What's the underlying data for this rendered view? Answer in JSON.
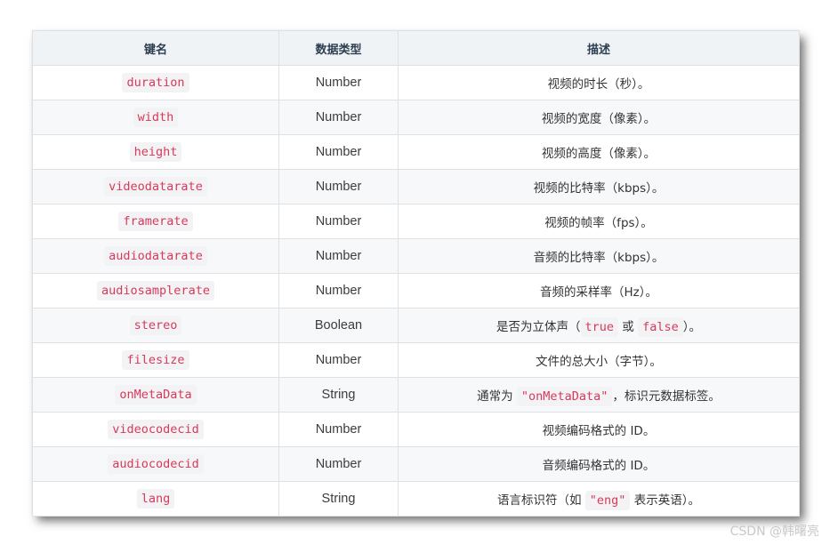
{
  "headers": [
    "键名",
    "数据类型",
    "描述"
  ],
  "rows": [
    {
      "key": "duration",
      "type": "Number",
      "desc": [
        {
          "t": "视频的时长（秒）。"
        }
      ]
    },
    {
      "key": "width",
      "type": "Number",
      "desc": [
        {
          "t": "视频的宽度（像素）。"
        }
      ]
    },
    {
      "key": "height",
      "type": "Number",
      "desc": [
        {
          "t": "视频的高度（像素）。"
        }
      ]
    },
    {
      "key": "videodatarate",
      "type": "Number",
      "desc": [
        {
          "t": "视频的比特率（kbps）。"
        }
      ]
    },
    {
      "key": "framerate",
      "type": "Number",
      "desc": [
        {
          "t": "视频的帧率（fps）。"
        }
      ]
    },
    {
      "key": "audiodatarate",
      "type": "Number",
      "desc": [
        {
          "t": "音频的比特率（kbps）。"
        }
      ]
    },
    {
      "key": "audiosamplerate",
      "type": "Number",
      "desc": [
        {
          "t": "音频的采样率（Hz）。"
        }
      ]
    },
    {
      "key": "stereo",
      "type": "Boolean",
      "desc": [
        {
          "t": "是否为立体声（"
        },
        {
          "c": "true"
        },
        {
          "t": " 或 "
        },
        {
          "c": "false"
        },
        {
          "t": "）。"
        }
      ]
    },
    {
      "key": "filesize",
      "type": "Number",
      "desc": [
        {
          "t": "文件的总大小（字节）。"
        }
      ]
    },
    {
      "key": "onMetaData",
      "type": "String",
      "desc": [
        {
          "t": "通常为 "
        },
        {
          "c": "\"onMetaData\""
        },
        {
          "t": "，标识元数据标签。"
        }
      ]
    },
    {
      "key": "videocodecid",
      "type": "Number",
      "desc": [
        {
          "t": "视频编码格式的 ID。"
        }
      ]
    },
    {
      "key": "audiocodecid",
      "type": "Number",
      "desc": [
        {
          "t": "音频编码格式的 ID。"
        }
      ]
    },
    {
      "key": "lang",
      "type": "String",
      "desc": [
        {
          "t": "语言标识符（如 "
        },
        {
          "c": "\"eng\""
        },
        {
          "t": " 表示英语）。"
        }
      ]
    }
  ],
  "watermark": "CSDN @韩曙亮"
}
